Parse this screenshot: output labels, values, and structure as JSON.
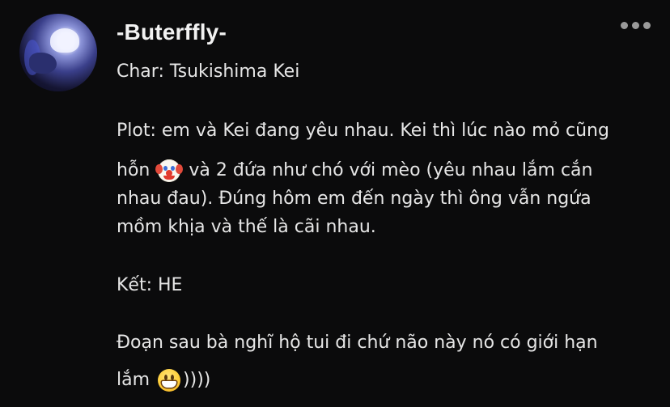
{
  "post": {
    "author": {
      "username": "-Buterffly-"
    },
    "lines": {
      "char": "Char: Tsukishima Kei",
      "plot_1": "Plot: em và Kei đang yêu nhau. Kei thì lúc nào mỏ cũng",
      "plot_2a": "hỗn",
      "plot_2b": "và 2 đứa như chó với mèo (yêu nhau lắm cắn",
      "plot_3": "nhau đau). Đúng hôm em đến ngày thì ông vẫn ngứa",
      "plot_4": "mồm khịa và thế là cãi nhau.",
      "ending": "Kết: HE",
      "note_1": "Đoạn sau bà nghĩ hộ tui đi chứ não này nó có giới hạn",
      "note_2a": "lắm",
      "note_2b": "))))"
    },
    "emojis": {
      "plot_emoji": "clown-face-emoji",
      "note_emoji": "grinning-face-emoji"
    }
  },
  "colors": {
    "background": "#0b0b0c",
    "text": "#e6e6e6",
    "menu_dots": "#9a9a9a"
  }
}
